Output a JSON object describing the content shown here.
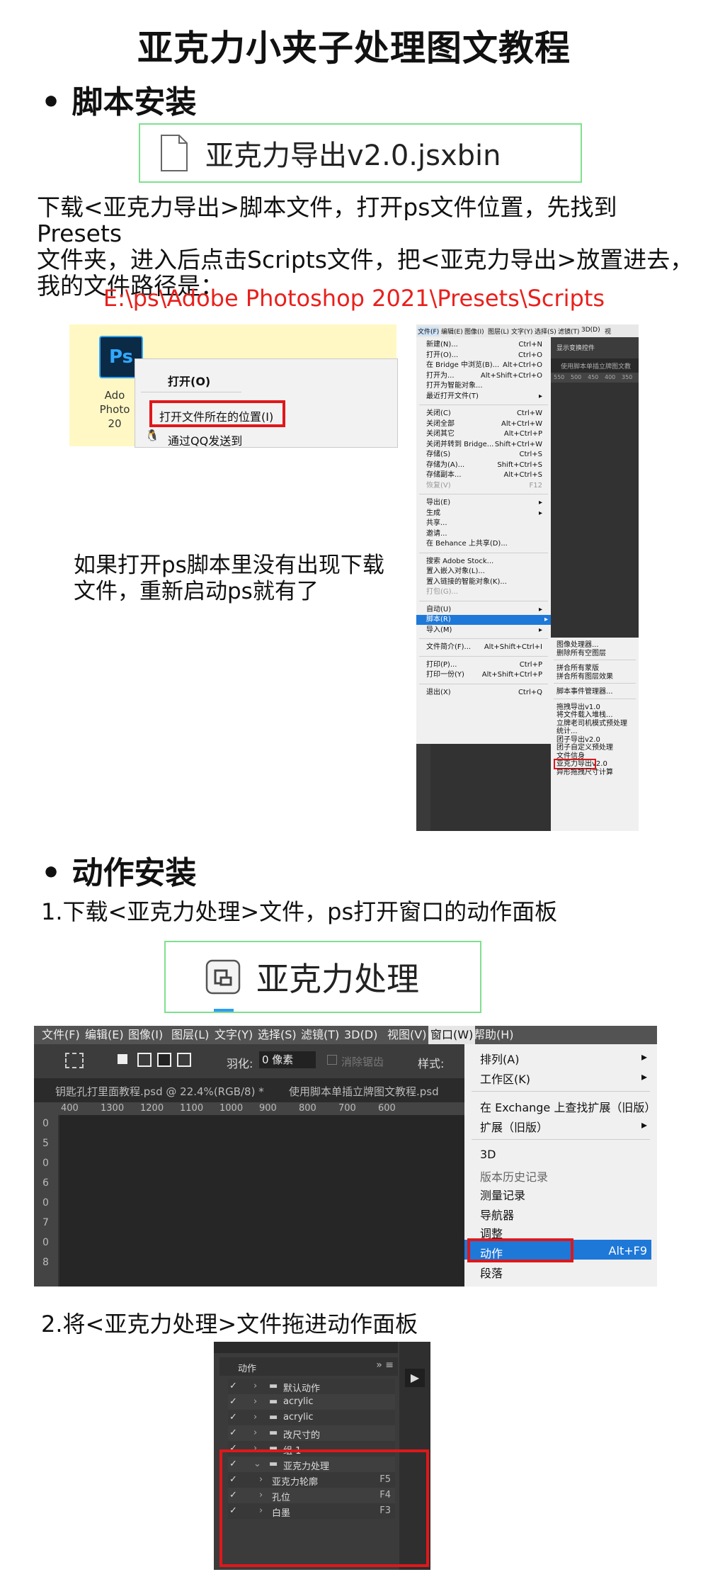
{
  "title": "亚克力小夹子处理图文教程",
  "section1": {
    "heading": "• 脚本安装",
    "file_name": "亚克力导出v2.0.jsxbin",
    "para_lines": [
      "下载<亚克力导出>脚本文件，打开ps文件位置，先找到Presets",
      "文件夹，进入后点击Scripts文件，把<亚克力导出>放置进去，",
      "我的文件路径是："
    ],
    "path": "E:\\ps\\Adobe Photoshop 2021\\Presets\\Scripts",
    "path_color": "#e8201c",
    "desktop": {
      "icon_label": "Ps",
      "icon_caption_lines": [
        "Ado",
        "Photo",
        "20"
      ],
      "menu": [
        "打开(O)",
        "打开文件所在的位置(I)",
        "通过QQ发送到"
      ]
    },
    "note_lines": [
      "如果打开ps脚本里没有出现下载",
      "文件，重新启动ps就有了"
    ],
    "ps_file_menu": {
      "menubar": [
        "文件(F)",
        "编辑(E)",
        "图像(I)",
        "图层(L)",
        "文字(Y)",
        "选择(S)",
        "滤镜(T)",
        "3D(D)",
        "视"
      ],
      "toolbar_text": "显示变换控件",
      "tab_text": "使用脚本单插立牌图文教",
      "ruler": [
        "550",
        "500",
        "450",
        "400",
        "350"
      ],
      "groups": [
        [
          [
            "新建(N)...",
            "Ctrl+N"
          ],
          [
            "打开(O)...",
            "Ctrl+O"
          ],
          [
            "在 Bridge 中浏览(B)...",
            "Alt+Ctrl+O"
          ],
          [
            "打开为...",
            "Alt+Shift+Ctrl+O"
          ],
          [
            "打开为智能对象...",
            ""
          ],
          [
            "最近打开文件(T)",
            "▸"
          ]
        ],
        [
          [
            "关闭(C)",
            "Ctrl+W"
          ],
          [
            "关闭全部",
            "Alt+Ctrl+W"
          ],
          [
            "关闭其它",
            "Alt+Ctrl+P"
          ],
          [
            "关闭并转到 Bridge...",
            "Shift+Ctrl+W"
          ],
          [
            "存储(S)",
            "Ctrl+S"
          ],
          [
            "存储为(A)...",
            "Shift+Ctrl+S"
          ],
          [
            "存储副本...",
            "Alt+Ctrl+S"
          ],
          [
            "恢复(V)",
            "F12"
          ]
        ],
        [
          [
            "导出(E)",
            "▸"
          ],
          [
            "生成",
            "▸"
          ],
          [
            "共享...",
            ""
          ],
          [
            "邀请...",
            ""
          ],
          [
            "在 Behance 上共享(D)...",
            ""
          ]
        ],
        [
          [
            "搜索 Adobe Stock...",
            ""
          ],
          [
            "置入嵌入对象(L)...",
            ""
          ],
          [
            "置入链接的智能对象(K)...",
            ""
          ],
          [
            "打包(G)...",
            ""
          ]
        ],
        [
          [
            "自动(U)",
            "▸"
          ],
          [
            "脚本(R)",
            "▸"
          ],
          [
            "导入(M)",
            "▸"
          ]
        ],
        [
          [
            "文件简介(F)...",
            "Alt+Shift+Ctrl+I"
          ]
        ],
        [
          [
            "打印(P)...",
            "Ctrl+P"
          ],
          [
            "打印一份(Y)",
            "Alt+Shift+Ctrl+P"
          ]
        ],
        [
          [
            "退出(X)",
            "Ctrl+Q"
          ]
        ]
      ],
      "submenu": [
        [
          "图像处理器...",
          "删除所有空图层"
        ],
        [
          "拼合所有蒙版",
          "拼合所有图层效果"
        ],
        [
          "脚本事件管理器..."
        ],
        [
          "拖拽导出v1.0",
          "将文件载入堆栈...",
          "立牌老司机模式预处理",
          "统计...",
          "团子导出v2.0",
          "团子自定义预处理",
          "文件信身",
          "亚克力导出v2.0",
          "异形拖拽尺寸计算"
        ]
      ]
    }
  },
  "section2": {
    "heading": "• 动作安装",
    "step1": "1.下载<亚克力处理>文件，ps打开窗口的动作面板",
    "file_name": "亚克力处理",
    "ps_window": {
      "menubar": [
        "文件(F)",
        "编辑(E)",
        "图像(I)",
        "图层(L)",
        "文字(Y)",
        "选择(S)",
        "滤镜(T)",
        "3D(D)",
        "视图(V)",
        "窗口(W)",
        "帮助(H)"
      ],
      "options": [
        "羽化:",
        "0 像素",
        "消除锯齿",
        "样式:"
      ],
      "tabs": [
        "钥匙孔打里面教程.psd @ 22.4%(RGB/8) *",
        "使用脚本单插立牌图文教程.psd"
      ],
      "ruler": [
        "400",
        "1300",
        "1200",
        "1100",
        "1000",
        "900",
        "800",
        "700",
        "600"
      ],
      "vruler": [
        "0",
        "5",
        "0",
        "6",
        "0",
        "7",
        "0",
        "8"
      ],
      "menu": [
        [
          "排列(A)",
          "▸"
        ],
        [
          "工作区(K)",
          "▸"
        ],
        [
          "在 Exchange 上查找扩展（旧版）...",
          ""
        ],
        [
          "扩展（旧版）",
          "▸"
        ],
        [
          "3D",
          ""
        ],
        [
          "版本历史记录",
          ""
        ],
        [
          "测量记录",
          ""
        ],
        [
          "导航器",
          ""
        ],
        [
          "调整",
          ""
        ],
        [
          "动作",
          "Alt+F9"
        ],
        [
          "段落",
          ""
        ]
      ]
    },
    "step2": "2.将<亚克力处理>文件拖进动作面板",
    "actions_panel": {
      "title": "动作",
      "rows": [
        [
          "默认动作",
          ""
        ],
        [
          "acrylic",
          ""
        ],
        [
          "acrylic",
          ""
        ],
        [
          "改尺寸的",
          ""
        ],
        [
          "组 1",
          ""
        ],
        [
          "亚克力处理",
          ""
        ],
        [
          "亚克力轮廓",
          "F5"
        ],
        [
          "孔位",
          "F4"
        ],
        [
          "白墨",
          "F3"
        ]
      ]
    }
  }
}
